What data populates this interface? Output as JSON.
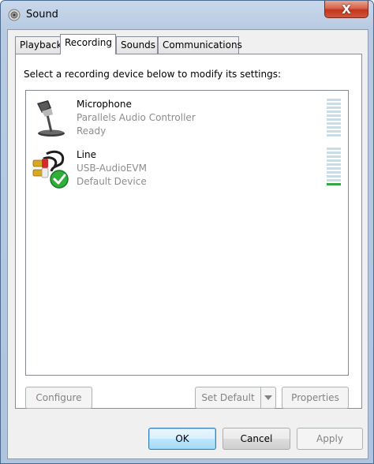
{
  "window": {
    "title": "Sound",
    "close_label": "X"
  },
  "tabs": [
    {
      "label": "Playback",
      "active": false
    },
    {
      "label": "Recording",
      "active": true
    },
    {
      "label": "Sounds",
      "active": false
    },
    {
      "label": "Communications",
      "active": false
    }
  ],
  "panel": {
    "instruction": "Select a recording device below to modify its settings:"
  },
  "devices": [
    {
      "name": "Microphone",
      "description": "Parallels Audio Controller",
      "status": "Ready",
      "icon": "microphone-icon",
      "default": false,
      "level_bars_on": 0,
      "level_bars_total": 10
    },
    {
      "name": "Line",
      "description": "USB-AudioEVM",
      "status": "Default Device",
      "icon": "line-in-cable-icon",
      "default": true,
      "level_bars_on": 1,
      "level_bars_total": 10
    }
  ],
  "buttons": {
    "configure": "Configure",
    "set_default": "Set Default",
    "properties": "Properties",
    "ok": "OK",
    "cancel": "Cancel",
    "apply": "Apply"
  },
  "colors": {
    "meter_off": "#c8dde6",
    "meter_on": "#36a83f",
    "default_check": "#2fae3a",
    "close_button": "#c2371e"
  }
}
